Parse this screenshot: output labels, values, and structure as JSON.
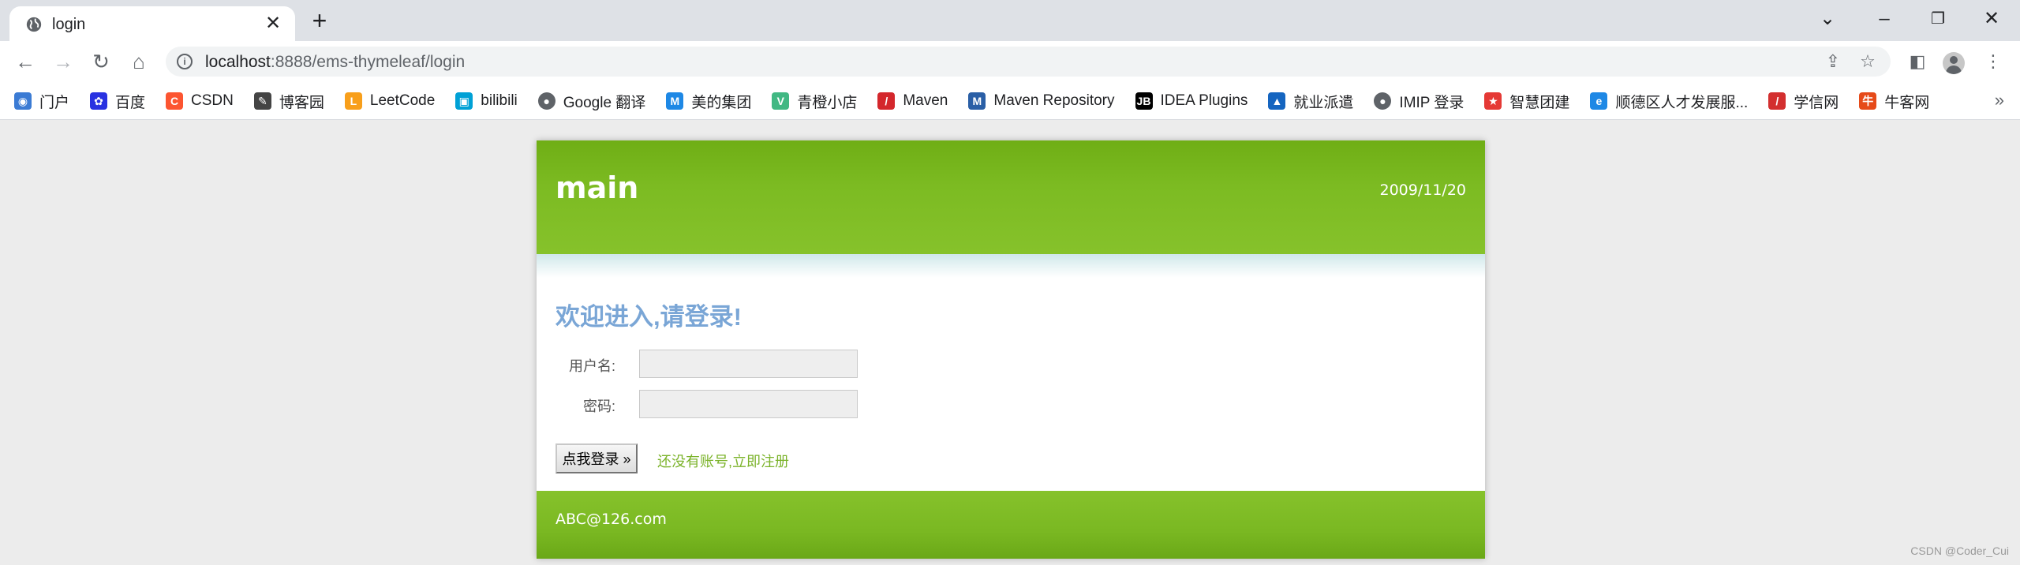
{
  "browser": {
    "tab": {
      "title": "login",
      "favicon": "globe-icon"
    },
    "address": {
      "host": "localhost",
      "path": ":8888/ems-thymeleaf/login"
    },
    "bookmarks": [
      {
        "label": "门户",
        "icon": "portal-icon",
        "color": "#3b7bd4"
      },
      {
        "label": "百度",
        "icon": "paw-icon",
        "color": "#2932e1"
      },
      {
        "label": "CSDN",
        "icon": "csdn-icon",
        "color": "#fc5531"
      },
      {
        "label": "博客园",
        "icon": "cnblogs-icon",
        "color": "#444444"
      },
      {
        "label": "LeetCode",
        "icon": "leetcode-icon",
        "color": "#f89f1b"
      },
      {
        "label": "bilibili",
        "icon": "bilibili-icon",
        "color": "#00a1d6"
      },
      {
        "label": "Google 翻译",
        "icon": "globe-icon",
        "color": "#5f6368"
      },
      {
        "label": "美的集团",
        "icon": "midea-icon",
        "color": "#1e88e5"
      },
      {
        "label": "青橙小店",
        "icon": "vue-icon",
        "color": "#41b883"
      },
      {
        "label": "Maven",
        "icon": "feather-icon",
        "color": "#d4272c"
      },
      {
        "label": "Maven Repository",
        "icon": "mvn-icon",
        "color": "#2a5fa6"
      },
      {
        "label": "IDEA Plugins",
        "icon": "jetbrains-icon",
        "color": "#000000"
      },
      {
        "label": "就业派遣",
        "icon": "graduation-cap-icon",
        "color": "#1565c0"
      },
      {
        "label": "IMIP 登录",
        "icon": "globe-icon",
        "color": "#5f6368"
      },
      {
        "label": "智慧团建",
        "icon": "emblem-icon",
        "color": "#e53935"
      },
      {
        "label": "顺德区人才发展服...",
        "icon": "edge-icon",
        "color": "#1e88e5"
      },
      {
        "label": "学信网",
        "icon": "chsi-icon",
        "color": "#d32f2f"
      },
      {
        "label": "牛客网",
        "icon": "nowcoder-icon",
        "color": "#e64a19"
      }
    ]
  },
  "page": {
    "header": {
      "title": "main",
      "date": "2009/11/20"
    },
    "login": {
      "heading": "欢迎进入,请登录!",
      "username_label": "用户名:",
      "username_value": "",
      "password_label": "密码:",
      "password_value": "",
      "submit_label": "点我登录 »",
      "register_link": "还没有账号,立即注册"
    },
    "footer": {
      "text": "ABC@126.com"
    },
    "colors": {
      "header_green": "#7cbb22",
      "heading_blue": "#7aa6d6",
      "link_green": "#7bb32a"
    }
  },
  "watermark": "CSDN @Coder_Cui"
}
